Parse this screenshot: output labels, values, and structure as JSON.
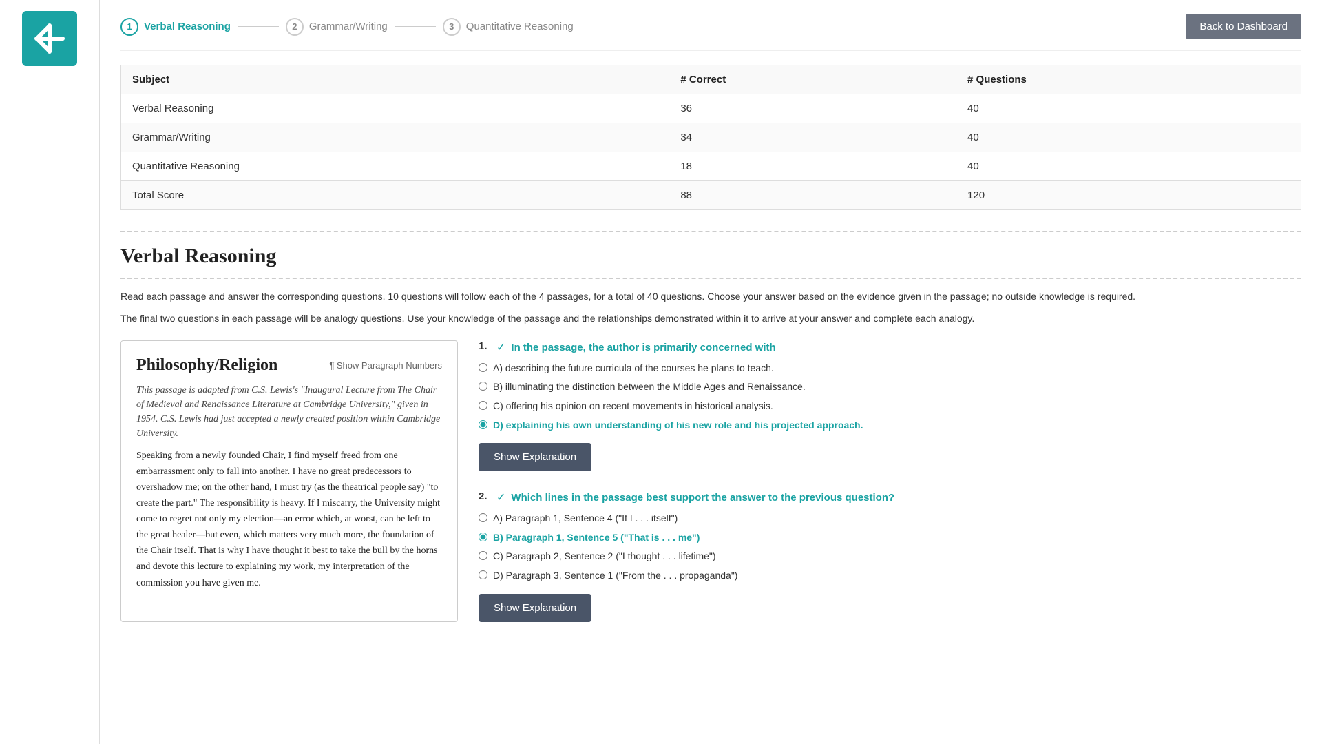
{
  "sidebar": {
    "logo_alt": "App Logo"
  },
  "nav": {
    "steps": [
      {
        "num": "1",
        "label": "Verbal Reasoning",
        "active": true
      },
      {
        "num": "2",
        "label": "Grammar/Writing",
        "active": false
      },
      {
        "num": "3",
        "label": "Quantitative Reasoning",
        "active": false
      }
    ],
    "back_button": "Back to Dashboard"
  },
  "score_table": {
    "headers": [
      "Subject",
      "# Correct",
      "# Questions"
    ],
    "rows": [
      {
        "subject": "Verbal Reasoning",
        "correct": "36",
        "questions": "40"
      },
      {
        "subject": "Grammar/Writing",
        "correct": "34",
        "questions": "40"
      },
      {
        "subject": "Quantitative Reasoning",
        "correct": "18",
        "questions": "40"
      },
      {
        "subject": "Total Score",
        "correct": "88",
        "questions": "120"
      }
    ]
  },
  "verbal_reasoning": {
    "title": "Verbal Reasoning",
    "instructions_1": "Read each passage and answer the corresponding questions. 10 questions will follow each of the 4 passages, for a total of 40 questions. Choose your answer based on the evidence given in the passage; no outside knowledge is required.",
    "instructions_2": "The final two questions in each passage will be analogy questions. Use your knowledge of the passage and the relationships demonstrated within it to arrive at your answer and complete each analogy."
  },
  "passage": {
    "title": "Philosophy/Religion",
    "show_para_label": "Show Paragraph Numbers",
    "para_symbol": "¶",
    "source": "This passage is adapted from C.S. Lewis's \"Inaugural Lecture from The Chair of Medieval and Renaissance Literature at Cambridge University,\" given in 1954. C.S. Lewis had just accepted a newly created position within Cambridge University.",
    "text": "Speaking from a newly founded Chair, I find myself freed from one embarrassment only to fall into another. I have no great predecessors to overshadow me; on the other hand, I must try (as the theatrical people say) \"to create the part.\" The responsibility is heavy. If I miscarry, the University might come to regret not only my election—an error which, at worst, can be left to the great healer—but even, which matters very much more, the foundation of the Chair itself. That is why I have thought it best to take the bull by the horns and devote this lecture to explaining my work, my interpretation of the commission you have given me."
  },
  "questions": [
    {
      "num": "1.",
      "icon": "✓",
      "text": "In the passage, the author is primarily concerned with",
      "options": [
        {
          "letter": "A)",
          "text": "describing the future curricula of the courses he plans to teach.",
          "selected": false,
          "correct": false
        },
        {
          "letter": "B)",
          "text": "illuminating the distinction between the Middle Ages and Renaissance.",
          "selected": false,
          "correct": false
        },
        {
          "letter": "C)",
          "text": "offering his opinion on recent movements in historical analysis.",
          "selected": false,
          "correct": false
        },
        {
          "letter": "D)",
          "text": "explaining his own understanding of his new role and his projected approach.",
          "selected": true,
          "correct": true
        }
      ],
      "show_explanation_label": "Show Explanation"
    },
    {
      "num": "2.",
      "icon": "✓",
      "text": "Which lines in the passage best support the answer to the previous question?",
      "options": [
        {
          "letter": "A)",
          "text": "Paragraph 1, Sentence 4 (\"If I . . . itself\")",
          "selected": false,
          "correct": false
        },
        {
          "letter": "B)",
          "text": "Paragraph 1, Sentence 5 (\"That is . . . me\")",
          "selected": true,
          "correct": true
        },
        {
          "letter": "C)",
          "text": "Paragraph 2, Sentence 2 (\"I thought . . . lifetime\")",
          "selected": false,
          "correct": false
        },
        {
          "letter": "D)",
          "text": "Paragraph 3, Sentence 1 (\"From the . . . propaganda\")",
          "selected": false,
          "correct": false
        }
      ],
      "show_explanation_label": "Show Explanation"
    }
  ]
}
